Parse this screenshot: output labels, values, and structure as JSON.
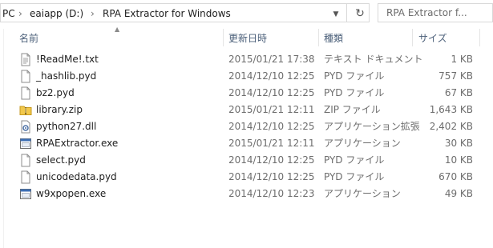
{
  "address_bar": {
    "crumbs": [
      "PC",
      "eaiapp (D:)",
      "RPA Extractor for Windows"
    ],
    "separator": "›",
    "dropdown_icon": "chevron-down-icon",
    "refresh_icon": "refresh-icon"
  },
  "search": {
    "placeholder": "RPA Extractor f..."
  },
  "columns": {
    "name": "名前",
    "date": "更新日時",
    "type": "種類",
    "size": "サイズ"
  },
  "files": [
    {
      "name": "!ReadMe!.txt",
      "date": "2015/01/21 17:38",
      "type": "テキスト ドキュメント",
      "size": "1 KB",
      "icon": "text-file-icon"
    },
    {
      "name": "_hashlib.pyd",
      "date": "2014/12/10 12:25",
      "type": "PYD ファイル",
      "size": "757 KB",
      "icon": "file-icon"
    },
    {
      "name": "bz2.pyd",
      "date": "2014/12/10 12:25",
      "type": "PYD ファイル",
      "size": "67 KB",
      "icon": "file-icon"
    },
    {
      "name": "library.zip",
      "date": "2015/01/21 12:11",
      "type": "ZIP ファイル",
      "size": "1,643 KB",
      "icon": "zip-folder-icon"
    },
    {
      "name": "python27.dll",
      "date": "2014/12/10 12:25",
      "type": "アプリケーション拡張",
      "size": "2,402 KB",
      "icon": "dll-icon"
    },
    {
      "name": "RPAExtractor.exe",
      "date": "2015/01/21 12:11",
      "type": "アプリケーション",
      "size": "30 KB",
      "icon": "exe-icon"
    },
    {
      "name": "select.pyd",
      "date": "2014/12/10 12:25",
      "type": "PYD ファイル",
      "size": "10 KB",
      "icon": "file-icon"
    },
    {
      "name": "unicodedata.pyd",
      "date": "2014/12/10 12:25",
      "type": "PYD ファイル",
      "size": "670 KB",
      "icon": "file-icon"
    },
    {
      "name": "w9xpopen.exe",
      "date": "2014/12/10 12:23",
      "type": "アプリケーション",
      "size": "49 KB",
      "icon": "exe-icon"
    }
  ]
}
